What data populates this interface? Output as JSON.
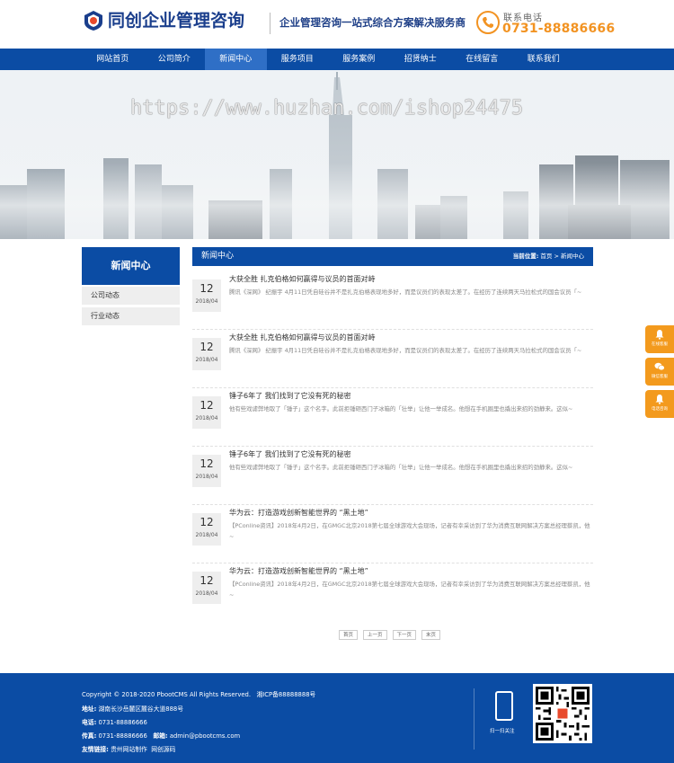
{
  "header": {
    "logo_text": "同创企业管理咨询",
    "slogan": "企业管理咨询一站式综合方案解决服务商",
    "phone_label": "联系电话",
    "phone_number": "0731-88886666"
  },
  "nav": {
    "items": [
      "网站首页",
      "公司简介",
      "新闻中心",
      "服务项目",
      "服务案例",
      "招贤纳士",
      "在线留言",
      "联系我们"
    ],
    "active_index": 2
  },
  "banner": {
    "watermark": "https://www.huzhan.com/ishop24475"
  },
  "sidebar": {
    "title": "新闻中心",
    "items": [
      "公司动态",
      "行业动态"
    ]
  },
  "content": {
    "title": "新闻中心",
    "breadcrumb_label": "当前位置:",
    "breadcrumb_home": "首页",
    "breadcrumb_sep": ">",
    "breadcrumb_current": "新闻中心"
  },
  "news": [
    {
      "day": "12",
      "ym": "2018/04",
      "title": "大获全胜 扎克伯格如何赢得与议员的首面对峙",
      "desc": "腾讯《深网》 纪振宇 4月11日凭自硅谷并不是扎克伯格表现地多好，而是议员们的表现太差了。在经历了连续两天马拉松式的国会议员「~"
    },
    {
      "day": "12",
      "ym": "2018/04",
      "title": "大获全胜 扎克伯格如何赢得与议员的首面对峙",
      "desc": "腾讯《深网》 纪振宇 4月11日凭自硅谷并不是扎克伯格表现地多好，而是议员们的表现太差了。在经历了连续两天马拉松式的国会议员「~"
    },
    {
      "day": "12",
      "ym": "2018/04",
      "title": "锤子6年了 我们找到了它没有死的秘密",
      "desc": "他有些戏谑弊地取了「锤子」这个名字。此前拒锤砸西门子冰箱的「壮举」让他一举成名。他想在手机圈里也撬出来招的劲静来。这似~"
    },
    {
      "day": "12",
      "ym": "2018/04",
      "title": "锤子6年了 我们找到了它没有死的秘密",
      "desc": "他有些戏谑弊地取了「锤子」这个名字。此前拒锤砸西门子冰箱的「壮举」让他一举成名。他想在手机圈里也撬出来招的劲静来。这似~"
    },
    {
      "day": "12",
      "ym": "2018/04",
      "title": "华为云：打造游戏创新智能世界的 “黑土地”",
      "desc": "【PConline资讯】2018年4月2日，在GMGC北京2018第七届全球游戏大会现场，记者有幸采访到了华为消费互联网解决方案总经理蔡凯，他~"
    },
    {
      "day": "12",
      "ym": "2018/04",
      "title": "华为云：打造游戏创新智能世界的 “黑土地”",
      "desc": "【PConline资讯】2018年4月2日，在GMGC北京2018第七届全球游戏大会现场，记者有幸采访到了华为消费互联网解决方案总经理蔡凯，他~"
    }
  ],
  "pager": [
    "首页",
    "上一页",
    "下一页",
    "末页"
  ],
  "float": [
    {
      "label": "在线客服",
      "icon": "bell-icon"
    },
    {
      "label": "微信客服",
      "icon": "wechat-icon"
    },
    {
      "label": "电话咨询",
      "icon": "phone-icon"
    }
  ],
  "footer": {
    "copyright": "Copyright © 2018-2020 PbootCMS All Rights Reserved.",
    "icp": "湘ICP备88888888号",
    "address_label": "地址:",
    "address": "湖南长沙岳麓区麓谷大道888号",
    "tel_label": "电话:",
    "tel": "0731-88886666",
    "fax_label": "传真:",
    "fax": "0731-88886666",
    "email_label": "邮箱:",
    "email": "admin@pbootcms.com",
    "links_label": "友情链接:",
    "links": [
      "贵州网站制作",
      "网创源码"
    ],
    "scan_label": "扫一扫关注"
  },
  "colors": {
    "primary": "#0b4ca4",
    "accent": "#f39a1d"
  }
}
